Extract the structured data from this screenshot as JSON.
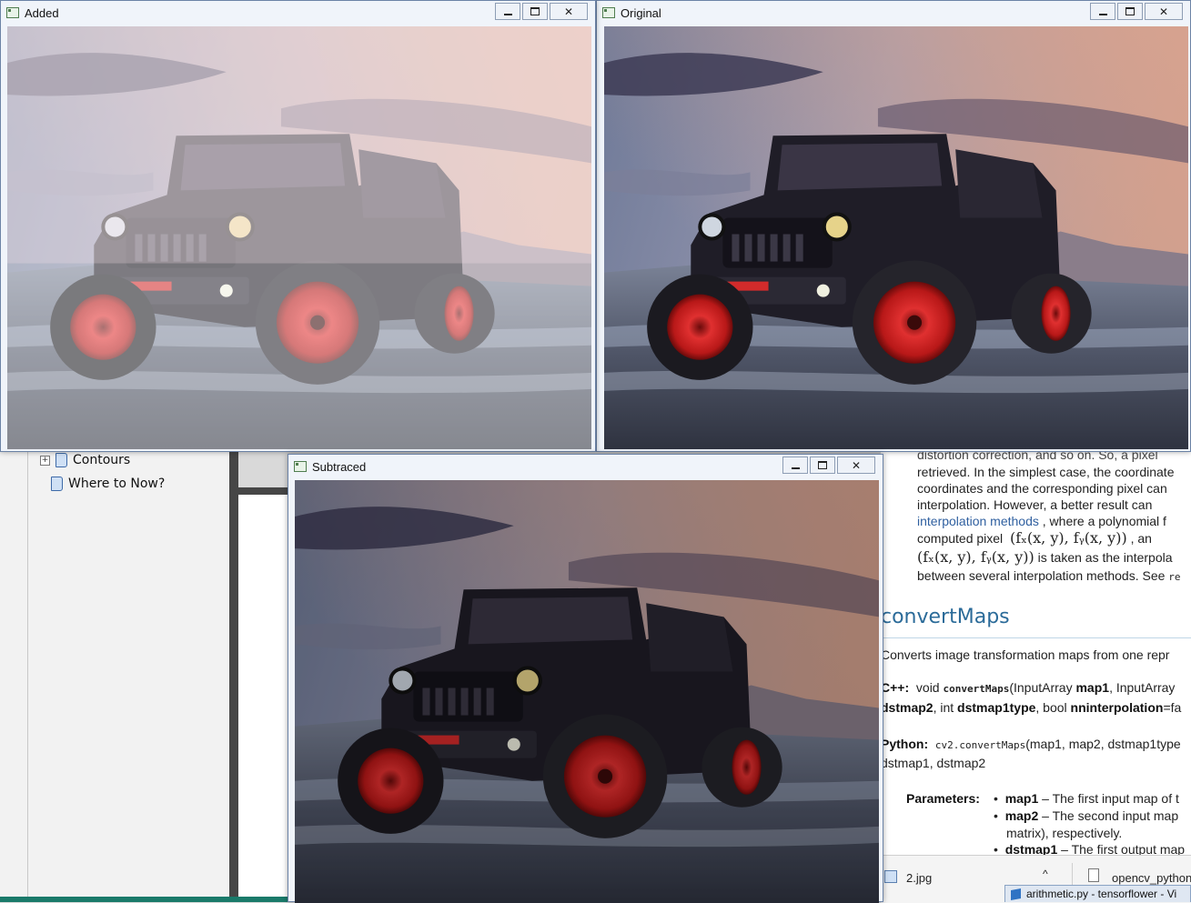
{
  "windows": {
    "added": {
      "title": "Added"
    },
    "original": {
      "title": "Original"
    },
    "subtracted": {
      "title": "Subtraced"
    }
  },
  "sidebar": {
    "items": [
      {
        "label": "Contours"
      },
      {
        "label": "Where to Now?"
      }
    ]
  },
  "doc": {
    "para1_line0": "distortion correction, and so on. So, a pixel",
    "para1_line1": "retrieved. In the simplest case, the coordinate",
    "para1_line2": "coordinates and the corresponding pixel can",
    "para1_line3": "interpolation. However, a better result can",
    "para1_link": "interpolation methods",
    "para1_line4_rest": " , where a polynomial f",
    "para1_line5_a": "computed  pixel",
    "para1_line5_math": "(fₓ(x, y), fᵧ(x, y))",
    "para1_line5_b": ",  an",
    "para1_line6_math": "(fₓ(x, y), fᵧ(x, y))",
    "para1_line6_b": " is taken as the interpola",
    "para1_line7": "between several interpolation methods. See",
    "para1_line7_code": "re",
    "heading": "convertMaps",
    "summary": "Converts image transformation maps from one repr",
    "cpp_label": "C++:",
    "cpp_sig_a": "void",
    "cpp_sig_func": "convertMaps",
    "cpp_sig_b": "(InputArray",
    "cpp_sig_map1": "map1",
    "cpp_sig_c": ", InputArray",
    "cpp_line2_a": "dstmap2",
    "cpp_line2_b": ", int",
    "cpp_line2_c": "dstmap1type",
    "cpp_line2_d": ", bool",
    "cpp_line2_e": "nninterpolation",
    "cpp_line2_f": "=fa",
    "py_label": "Python:",
    "py_func": "cv2.convertMaps",
    "py_args": "(map1, map2, dstmap1type",
    "py_line2": "dstmap1, dstmap2",
    "params_label": "Parameters:",
    "param1_name": "map1",
    "param1_desc": " – The first input map of t",
    "param2_name": "map2",
    "param2_desc": " – The second input map",
    "param2_cont": "matrix), respectively.",
    "param3_name": "dstmap1",
    "param3_desc": " – The first output map"
  },
  "downloads": [
    {
      "name": "2.jpg"
    },
    {
      "name": "opencv_python"
    }
  ],
  "taskbar": {
    "vscode_title": "arithmetic.py - tensorflower - Vi"
  }
}
